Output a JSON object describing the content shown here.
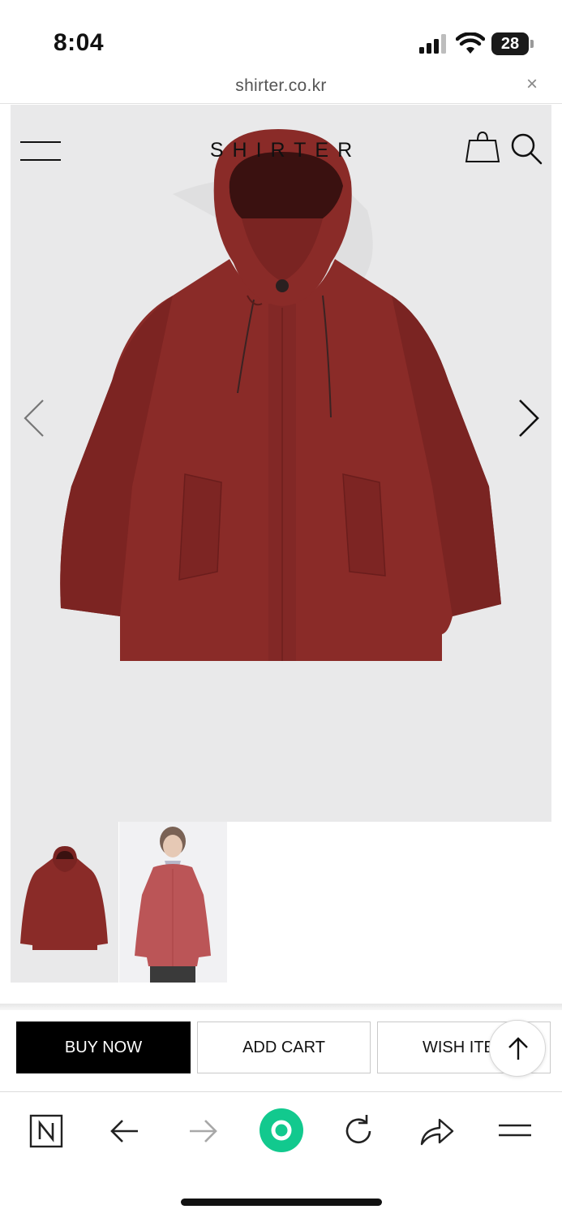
{
  "status_bar": {
    "time": "8:04",
    "battery": "28"
  },
  "browser": {
    "url": "shirter.co.kr",
    "close": "×"
  },
  "site": {
    "brand": "SHIRTER"
  },
  "product": {
    "accent_color": "#8c2a28"
  },
  "actions": {
    "buy_now": "BUY NOW",
    "add_cart": "ADD CART",
    "wish_item": "WISH ITEM"
  },
  "icons": {
    "menu": "menu-icon",
    "cart": "shopping-bag-icon",
    "search": "search-icon",
    "prev": "chevron-left-icon",
    "next": "chevron-right-icon",
    "top": "arrow-up-icon",
    "toolbar": [
      "naver-n-icon",
      "back-arrow-icon",
      "forward-arrow-icon",
      "green-dot-icon",
      "reload-icon",
      "share-icon",
      "hamburger-icon"
    ]
  }
}
